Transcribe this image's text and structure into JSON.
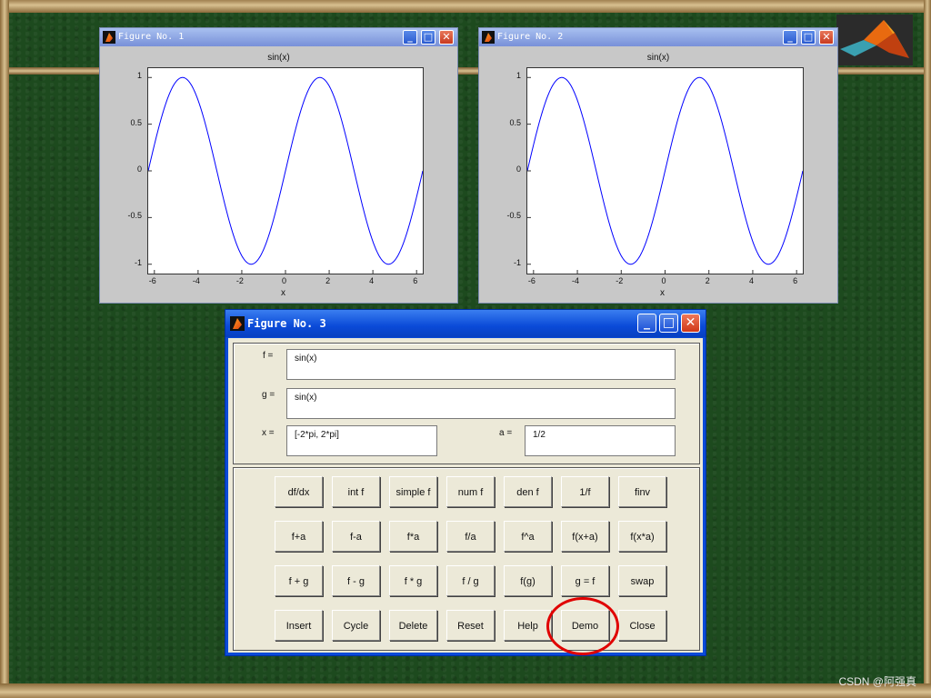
{
  "figure1": {
    "title": "Figure No. 1",
    "plot_title": "sin(x)",
    "xlabel": "x"
  },
  "figure2": {
    "title": "Figure No. 2",
    "plot_title": "sin(x)",
    "xlabel": "x"
  },
  "chart_data": [
    {
      "type": "line",
      "title": "sin(x)",
      "xlabel": "x",
      "ylabel": "",
      "xlim": [
        -6.2832,
        6.2832
      ],
      "ylim": [
        -1.1,
        1.1
      ],
      "xticks": [
        "-6",
        "-4",
        "-2",
        "0",
        "2",
        "4",
        "6"
      ],
      "yticks": [
        "1",
        "0.5",
        "0",
        "-0.5",
        "-1"
      ],
      "series": [
        {
          "function": "sin",
          "color": "#0000ff"
        }
      ],
      "grid": false
    },
    {
      "type": "line",
      "title": "sin(x)",
      "xlabel": "x",
      "ylabel": "",
      "xlim": [
        -6.2832,
        6.2832
      ],
      "ylim": [
        -1.1,
        1.1
      ],
      "xticks": [
        "-6",
        "-4",
        "-2",
        "0",
        "2",
        "4",
        "6"
      ],
      "yticks": [
        "1",
        "0.5",
        "0",
        "-0.5",
        "-1"
      ],
      "series": [
        {
          "function": "sin",
          "color": "#0000ff"
        }
      ],
      "grid": false
    }
  ],
  "figure3": {
    "title": "Figure No. 3",
    "f_label": "f =",
    "f_value": "sin(x)",
    "g_label": "g =",
    "g_value": "sin(x)",
    "x_label": "x =",
    "x_value": "[-2*pi, 2*pi]",
    "a_label": "a =",
    "a_value": "1/2",
    "buttons": [
      [
        "df/dx",
        "int f",
        "simple f",
        "num f",
        "den f",
        "1/f",
        "finv"
      ],
      [
        "f+a",
        "f-a",
        "f*a",
        "f/a",
        "f^a",
        "f(x+a)",
        "f(x*a)"
      ],
      [
        "f + g",
        "f - g",
        "f * g",
        "f / g",
        "f(g)",
        "g = f",
        "swap"
      ],
      [
        "Insert",
        "Cycle",
        "Delete",
        "Reset",
        "Help",
        "Demo",
        "Close"
      ]
    ]
  },
  "watermark": "CSDN @阿强真"
}
